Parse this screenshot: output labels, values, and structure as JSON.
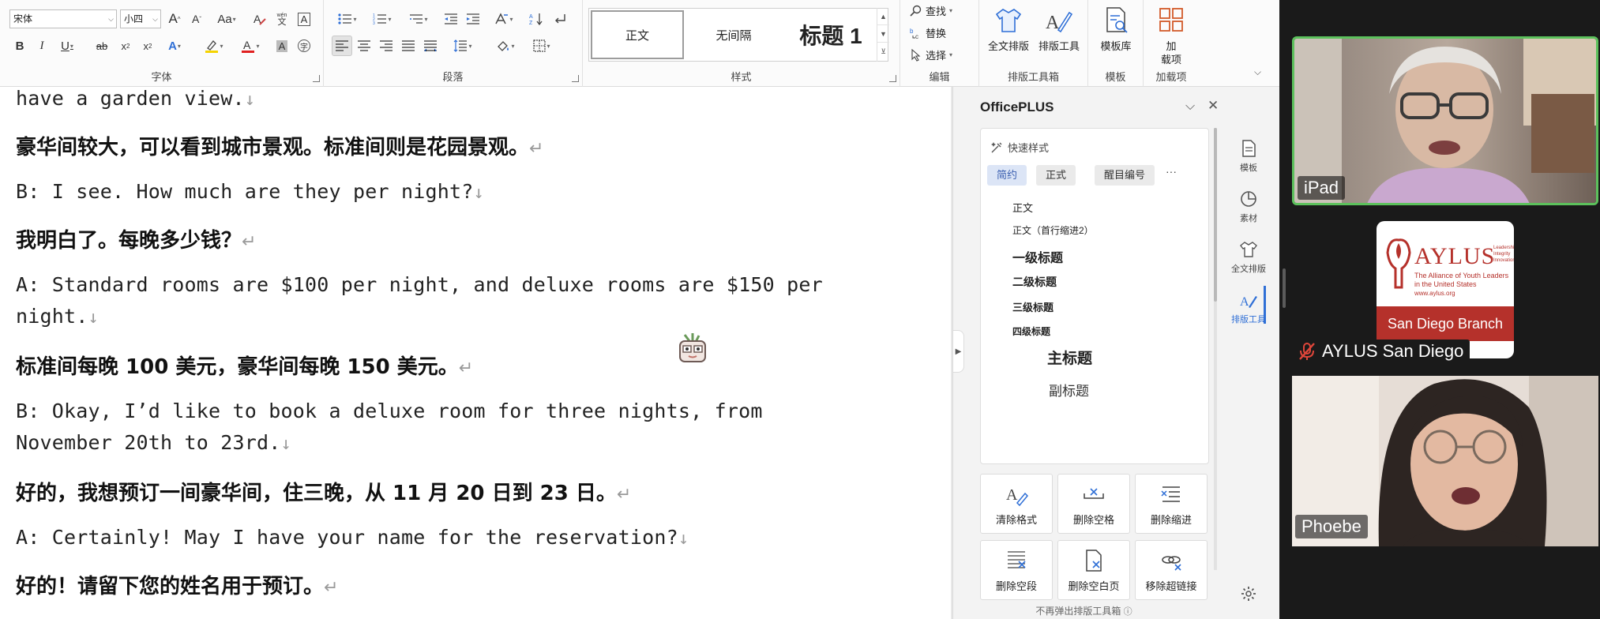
{
  "ribbon": {
    "font_name": "宋体",
    "font_size": "小四",
    "styles": [
      "正文",
      "无间隔",
      "标题 1"
    ],
    "find": "查找",
    "replace": "替换",
    "select": "选择",
    "big_buttons": [
      "全文排版",
      "排版工具",
      "模板库",
      "加载项"
    ],
    "load_label_1": "加",
    "load_label_2": "载项",
    "group_labels": [
      "字体",
      "段落",
      "样式",
      "编辑",
      "排版工具箱",
      "模板",
      "加载项"
    ]
  },
  "document": {
    "lines": [
      {
        "lang": "en",
        "text": "have a garden view."
      },
      {
        "lang": "zh",
        "text": "豪华间较大，可以看到城市景观。标准间则是花园景观。"
      },
      {
        "lang": "en",
        "text": "B: I see. How much are they per night?"
      },
      {
        "lang": "zh",
        "text": "我明白了。每晚多少钱？"
      },
      {
        "lang": "en",
        "text": "A: Standard rooms are $100 per night, and deluxe rooms are $150 per"
      },
      {
        "lang": "en",
        "text": "night."
      },
      {
        "lang": "zh",
        "text": "标准间每晚 100 美元，豪华间每晚 150 美元。"
      },
      {
        "lang": "en",
        "text": "B: Okay, I’d like to book a deluxe room for three nights, from"
      },
      {
        "lang": "en",
        "text": "November 20th to 23rd."
      },
      {
        "lang": "zh",
        "text": "好的，我想预订一间豪华间，住三晚，从 11 月 20 日到 23 日。"
      },
      {
        "lang": "en",
        "text": "A: Certainly! May I have your name for the reservation?"
      },
      {
        "lang": "zh",
        "text": "好的！请留下您的姓名用于预订。"
      }
    ],
    "line_break_mark": "↓",
    "paragraph_mark": "↵"
  },
  "panel": {
    "title": "OfficePLUS",
    "quick_styles_label": "快速样式",
    "tabs": [
      "简约",
      "正式",
      "醒目编号"
    ],
    "more": "···",
    "styles": [
      "正文",
      "正文（首行缩进2）",
      "一级标题",
      "二级标题",
      "三级标题",
      "四级标题",
      "主标题",
      "副标题"
    ],
    "tools": [
      "清除格式",
      "删除空格",
      "删除缩进",
      "删除空段",
      "删除空白页",
      "移除超链接"
    ],
    "footer": "不再弹出排版工具箱",
    "rail": [
      "模板",
      "素材",
      "全文排版",
      "排版工具"
    ]
  },
  "video": {
    "participants": [
      {
        "name": "iPad",
        "active_speaker": true
      },
      {
        "name": "AYLUS San Diego",
        "muted": true
      },
      {
        "name": "Phoebe"
      }
    ],
    "logo": {
      "brand": "AYLUS",
      "side_words": [
        "Leadership",
        "Integrity",
        "Innovation"
      ],
      "tagline_1": "The Alliance of Youth Leaders",
      "tagline_2": "in the United States",
      "url": "www.aylus.org",
      "banner": "San Diego Branch"
    }
  },
  "colors": {
    "accent": "#2f6fd6",
    "speaker_border": "#5cc15c",
    "aylus_red": "#b5312b",
    "mute_red": "#e0463a"
  }
}
